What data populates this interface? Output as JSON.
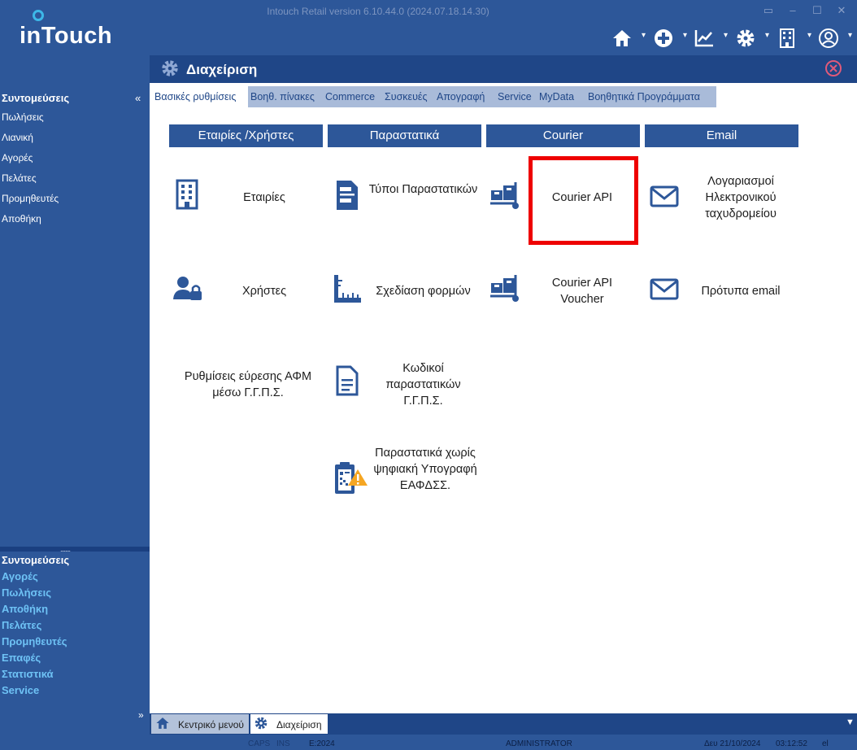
{
  "window": {
    "title": "Intouch Retail version 6.10.44.0 (2024.07.18.14.30)"
  },
  "logo": {
    "text": "inTouch"
  },
  "toolbar": {
    "icons": [
      "home-icon",
      "add-circle-icon",
      "chart-icon",
      "gear-icon",
      "building-icon",
      "user-circle-icon"
    ]
  },
  "sidebar": {
    "header": "Συντομεύσεις",
    "collapse": "«",
    "items": [
      {
        "label": "Πωλήσεις"
      },
      {
        "label": "Λιανική"
      },
      {
        "label": "Αγορές"
      },
      {
        "label": "Πελάτες"
      },
      {
        "label": "Προμηθευτές"
      },
      {
        "label": "Αποθήκη"
      }
    ],
    "grip": "........",
    "bottom_header": "Συντομεύσεις",
    "bottom_items": [
      {
        "label": "Αγορές"
      },
      {
        "label": "Πωλήσεις"
      },
      {
        "label": "Αποθήκη"
      },
      {
        "label": "Πελάτες"
      },
      {
        "label": "Προμηθευτές"
      },
      {
        "label": "Επαφές"
      },
      {
        "label": "Στατιστικά"
      },
      {
        "label": "Service"
      }
    ],
    "expand": "»"
  },
  "panel": {
    "title": "Διαχείριση",
    "tabs": [
      {
        "label": "Βασικές ρυθμίσεις"
      },
      {
        "label": "Βοηθ. πίνακες"
      },
      {
        "label": "Commerce"
      },
      {
        "label": "Συσκευές"
      },
      {
        "label": "Απογραφή"
      },
      {
        "label": "Service"
      },
      {
        "label": "MyData"
      },
      {
        "label": "Βοηθητικά Προγράμματα"
      }
    ],
    "sections": [
      {
        "label": "Εταιρίες /Χρήστες"
      },
      {
        "label": "Παραστατικά"
      },
      {
        "label": "Courier"
      },
      {
        "label": "Email"
      }
    ],
    "items": {
      "companies": "Εταιρίες",
      "users": "Χρήστες",
      "afm_settings": "Ρυθμίσεις εύρεσης ΑΦΜ μέσω Γ.Γ.Π.Σ.",
      "doc_types": "Τύποι Παραστατικών",
      "form_design": "Σχεδίαση φορμών",
      "doc_codes": "Κωδικοί παραστατικών Γ.Γ.Π.Σ.",
      "unsigned_docs": "Παραστατικά χωρίς ψηφιακή Υπογραφή ΕΑΦΔΣΣ.",
      "courier_api": "Courier API",
      "courier_api_voucher": "Courier API Voucher",
      "email_accounts": "Λογαριασμοί Ηλεκτρονικού ταχυδρομείου",
      "email_templates": "Πρότυπα email"
    }
  },
  "bottom_tabs": [
    {
      "label": "Κεντρικό μενού"
    },
    {
      "label": "Διαχείριση"
    }
  ],
  "status": {
    "caps": "CAPS",
    "ins": "INS",
    "year": "E:2024",
    "user": "ADMINISTRATOR",
    "date": "Δευ 21/10/2024",
    "time": "03:12:52",
    "lang": "el"
  },
  "colors": {
    "brand_blue": "#2d5799",
    "header_dark": "#1f4687",
    "tab_inactive": "#a9bbd9",
    "icon_blue": "#2d5799",
    "highlight_red": "#ee0000",
    "accent_cyan": "#3db8e8"
  }
}
